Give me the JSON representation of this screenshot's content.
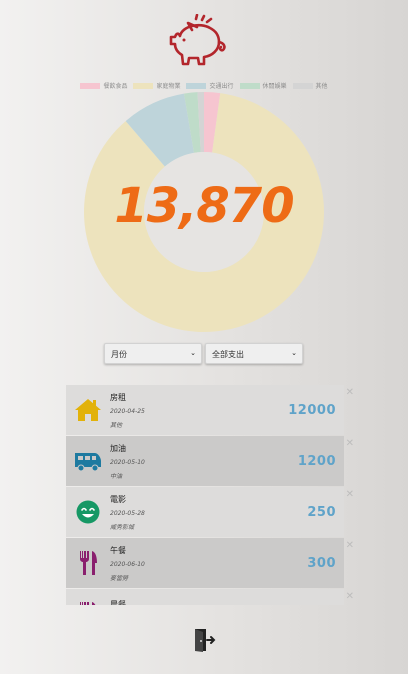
{
  "header": {
    "logo_icon": "piggy-bank-icon"
  },
  "legend": [
    {
      "label": "餐飲食品",
      "color": "#f6c5d0"
    },
    {
      "label": "家庭物業",
      "color": "#ede3bd"
    },
    {
      "label": "交通出行",
      "color": "#bed4da"
    },
    {
      "label": "休閒娛樂",
      "color": "#bfdcc9"
    },
    {
      "label": "其他",
      "color": "#d4d4d4"
    }
  ],
  "chart_data": {
    "type": "pie",
    "categories": [
      "其他",
      "家庭物業",
      "交通出行",
      "休閒娛樂",
      "餐飲食品"
    ],
    "values": [
      300,
      12000,
      1200,
      250,
      120
    ],
    "colors": [
      "#f6c5d0",
      "#ede3bd",
      "#bed4da",
      "#bfdcc9",
      "#d4d4d4"
    ],
    "center_total": "13,870"
  },
  "filters": {
    "period": "月份",
    "type": "全部支出"
  },
  "records": [
    {
      "name": "房租",
      "date": "2020-04-25",
      "note": "其他",
      "amount": "12000",
      "icon": "house-icon"
    },
    {
      "name": "加油",
      "date": "2020-05-10",
      "note": "中油",
      "amount": "1200",
      "icon": "van-icon"
    },
    {
      "name": "電影",
      "date": "2020-05-28",
      "note": "威秀影城",
      "amount": "250",
      "icon": "smile-icon"
    },
    {
      "name": "午餐",
      "date": "2020-06-10",
      "note": "麥當勞",
      "amount": "300",
      "icon": "fork-knife-icon"
    },
    {
      "name": "晨餐",
      "date": "",
      "note": "",
      "amount": "",
      "icon": "fork-knife-icon"
    }
  ],
  "footer": {
    "logout_icon": "logout-icon"
  }
}
